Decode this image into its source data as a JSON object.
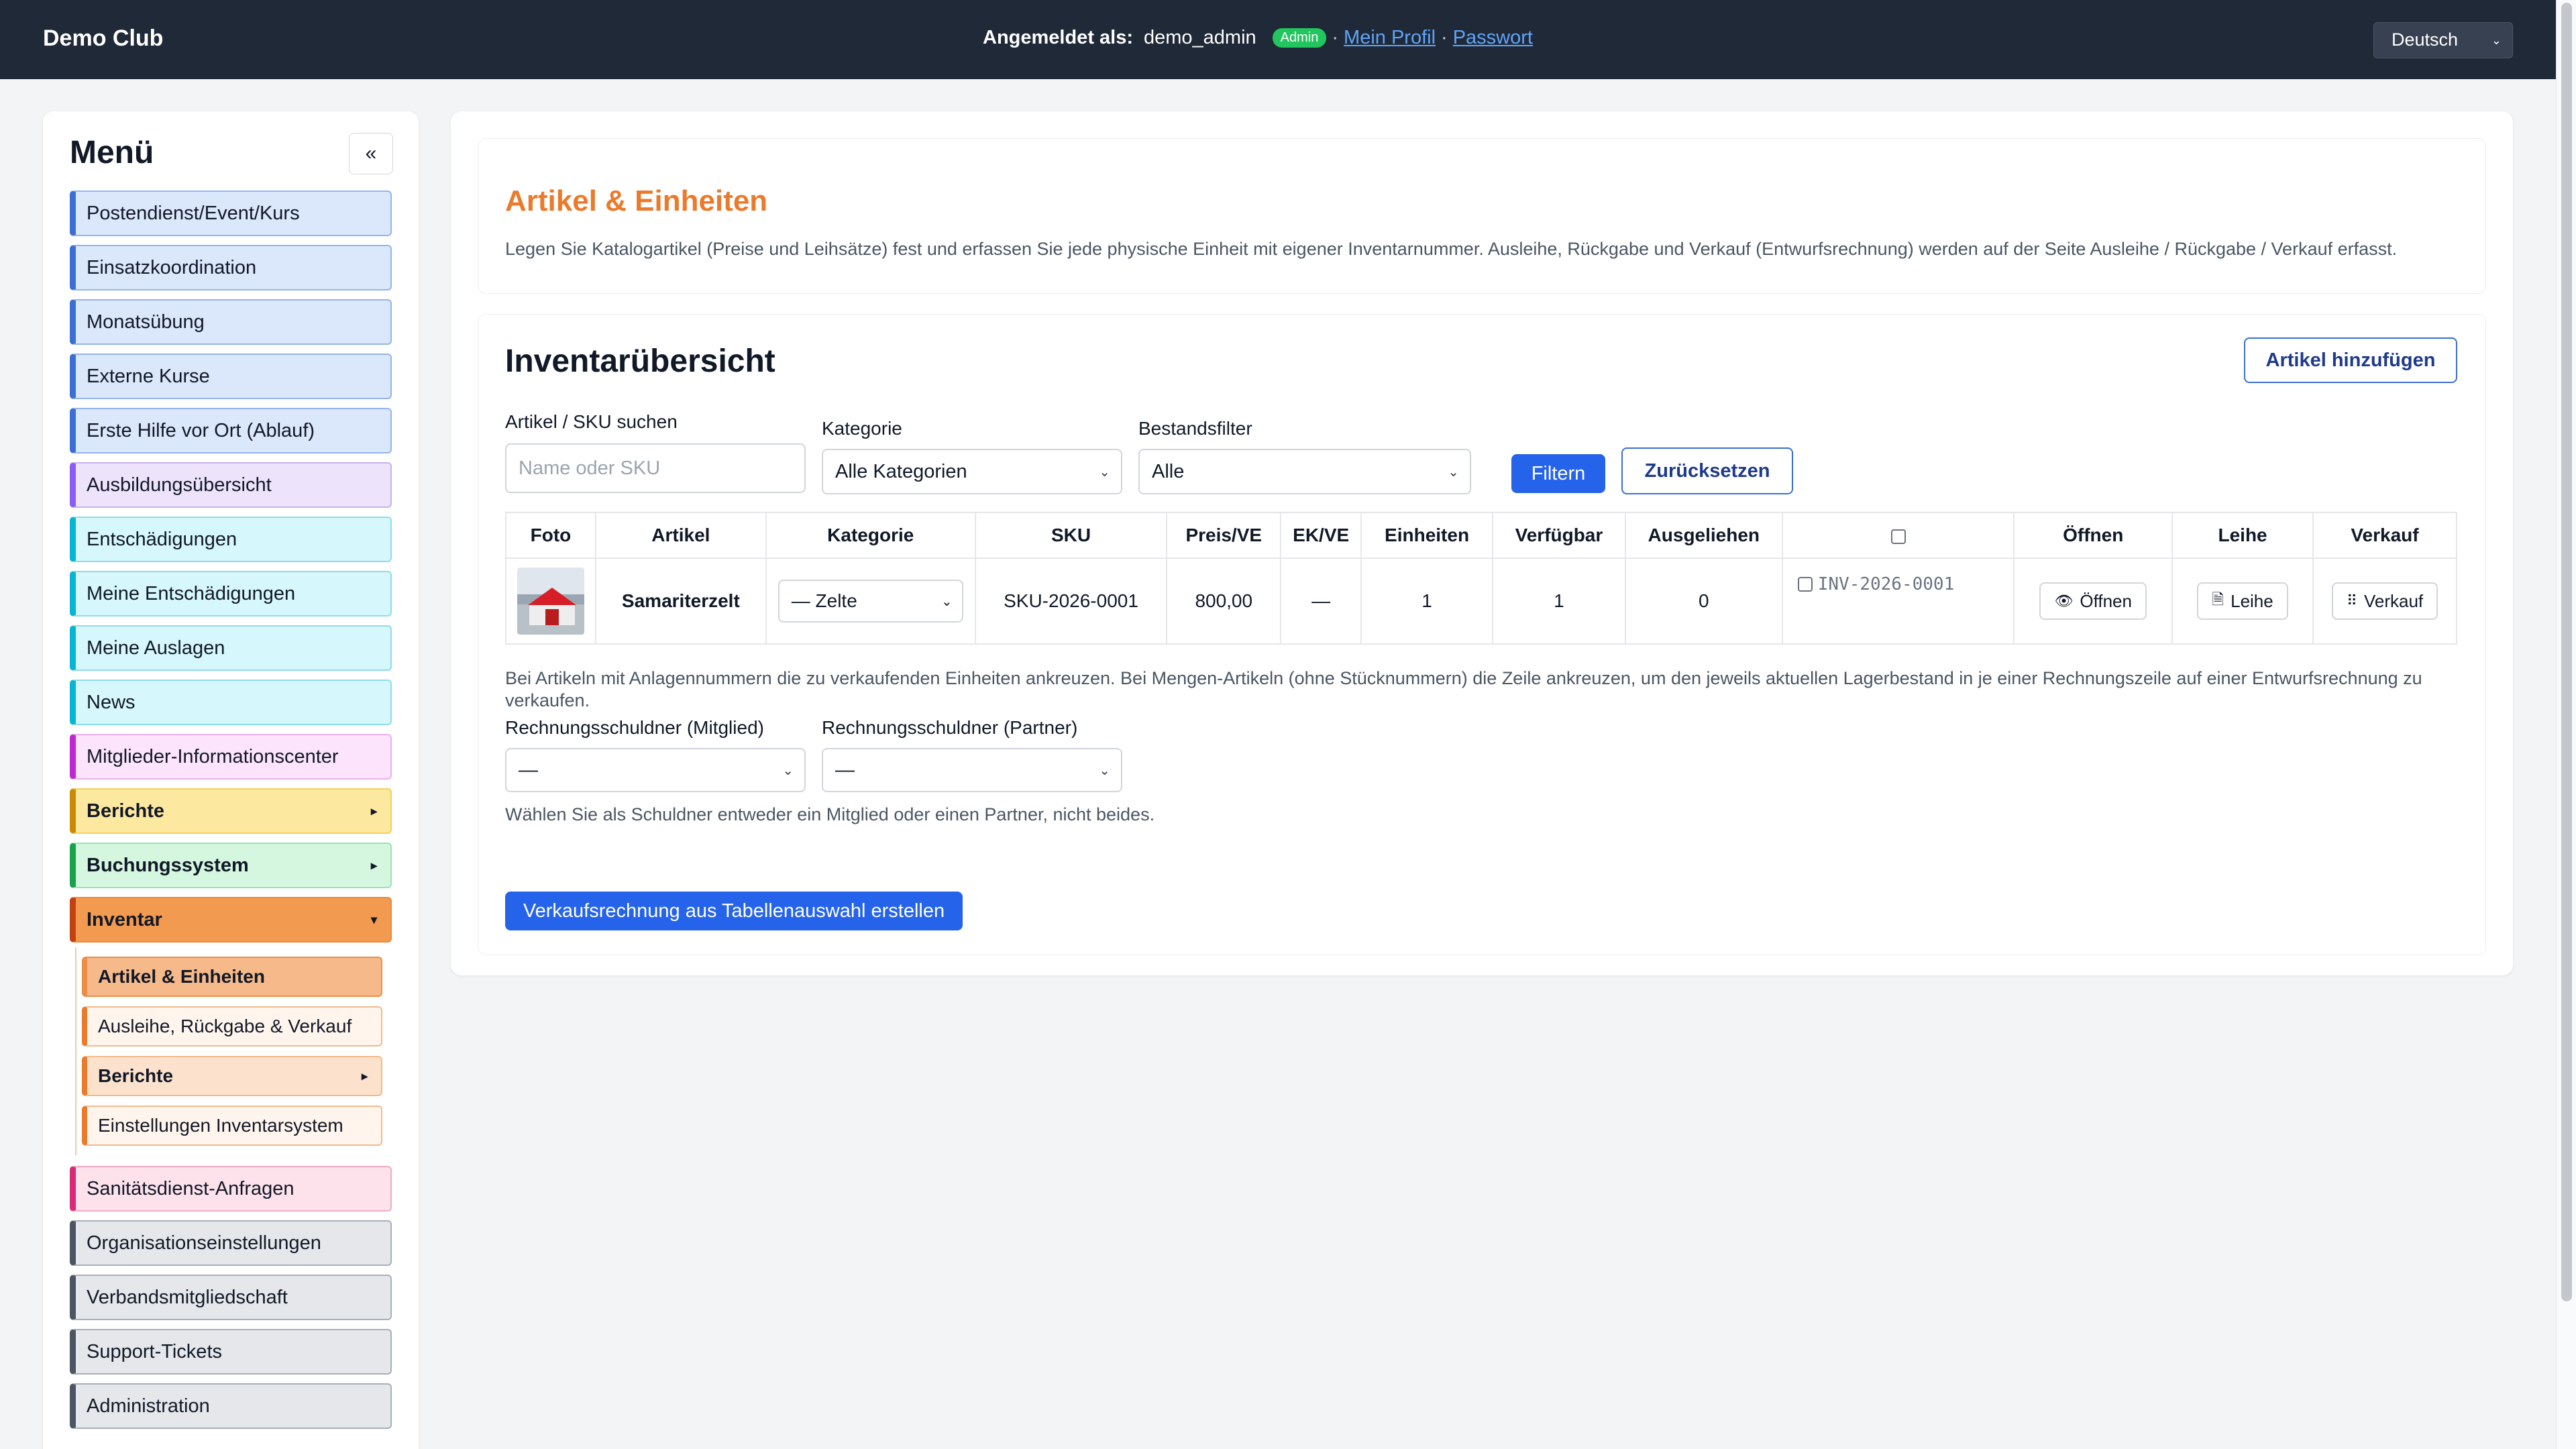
{
  "topbar": {
    "brand": "Demo Club",
    "logged_in_label": "Angemeldet als:",
    "username": "demo_admin",
    "role_badge": "Admin",
    "separator": "·",
    "profile_link": "Mein Profil",
    "password_link": "Passwort",
    "language": "Deutsch"
  },
  "sidebar": {
    "title": "Menü",
    "collapse_label": "«",
    "items": [
      {
        "label": "Postendienst/Event/Kurs"
      },
      {
        "label": "Einsatzkoordination"
      },
      {
        "label": "Monatsübung"
      },
      {
        "label": "Externe Kurse"
      },
      {
        "label": "Erste Hilfe vor Ort (Ablauf)"
      },
      {
        "label": "Ausbildungsübersicht"
      },
      {
        "label": "Entschädigungen"
      },
      {
        "label": "Meine Entschädigungen"
      },
      {
        "label": "Meine Auslagen"
      },
      {
        "label": "News"
      },
      {
        "label": "Mitglieder-Informationscenter"
      },
      {
        "label": "Berichte"
      },
      {
        "label": "Buchungssystem"
      },
      {
        "label": "Inventar"
      }
    ],
    "inventory_sub": [
      {
        "label": "Artikel & Einheiten"
      },
      {
        "label": "Ausleihe, Rückgabe & Verkauf"
      },
      {
        "label": "Berichte"
      },
      {
        "label": "Einstellungen Inventarsystem"
      }
    ],
    "items_after": [
      {
        "label": "Sanitätsdienst-Anfragen"
      },
      {
        "label": "Organisationseinstellungen"
      },
      {
        "label": "Verbandsmitgliedschaft"
      },
      {
        "label": "Support-Tickets"
      },
      {
        "label": "Administration"
      }
    ],
    "expand_arrow": "▸",
    "collapse_arrow": "▾"
  },
  "header_card": {
    "title": "Artikel & Einheiten",
    "description": "Legen Sie Katalogartikel (Preise und Leihsätze) fest und erfassen Sie jede physische Einheit mit eigener Inventarnummer. Ausleihe, Rückgabe und Verkauf (Entwurfsrechnung) werden auf der Seite Ausleihe / Rückgabe / Verkauf erfasst."
  },
  "inventory": {
    "title": "Inventarübersicht",
    "add_button": "Artikel hinzufügen",
    "filters": {
      "search_label": "Artikel / SKU suchen",
      "search_placeholder": "Name oder SKU",
      "category_label": "Kategorie",
      "category_value": "Alle Kategorien",
      "stock_label": "Bestandsfilter",
      "stock_value": "Alle",
      "filter_button": "Filtern",
      "reset_button": "Zurücksetzen"
    },
    "columns": [
      "Foto",
      "Artikel",
      "Kategorie",
      "SKU",
      "Preis/VE",
      "EK/VE",
      "Einheiten",
      "Verfügbar",
      "Ausgeliehen",
      "",
      "Öffnen",
      "Leihe",
      "Verkauf"
    ],
    "rows": [
      {
        "article": "Samariterzelt",
        "category": "— Zelte",
        "sku": "SKU-2026-0001",
        "price": "800,00",
        "cost": "—",
        "units": "1",
        "available": "1",
        "lent": "0",
        "inventory_no": "INV-2026-0001",
        "open_label": "Öffnen",
        "lend_label": "Leihe",
        "sell_label": "Verkauf"
      }
    ],
    "note": "Bei Artikeln mit Anlagennummern die zu verkaufenden Einheiten ankreuzen. Bei Mengen-Artikeln (ohne Stücknummern) die Zeile ankreuzen, um den jeweils aktuellen Lagerbestand in je einer Rechnungszeile auf einer Entwurfsrechnung zu verkaufen.",
    "debtor_member_label": "Rechnungsschuldner (Mitglied)",
    "debtor_member_value": "—",
    "debtor_partner_label": "Rechnungsschuldner (Partner)",
    "debtor_partner_value": "—",
    "debtor_note": "Wählen Sie als Schuldner entweder ein Mitglied oder einen Partner, nicht beides.",
    "create_button": "Verkaufsrechnung aus Tabellenauswahl erstellen"
  },
  "icons": {
    "eye": "eye-icon",
    "document": "document-icon",
    "dots": "dots-icon"
  },
  "colors": {
    "topbar": "#1f2937",
    "accent_orange": "#ea7a2c",
    "primary_blue": "#2563eb",
    "badge_green": "#22c55e"
  }
}
